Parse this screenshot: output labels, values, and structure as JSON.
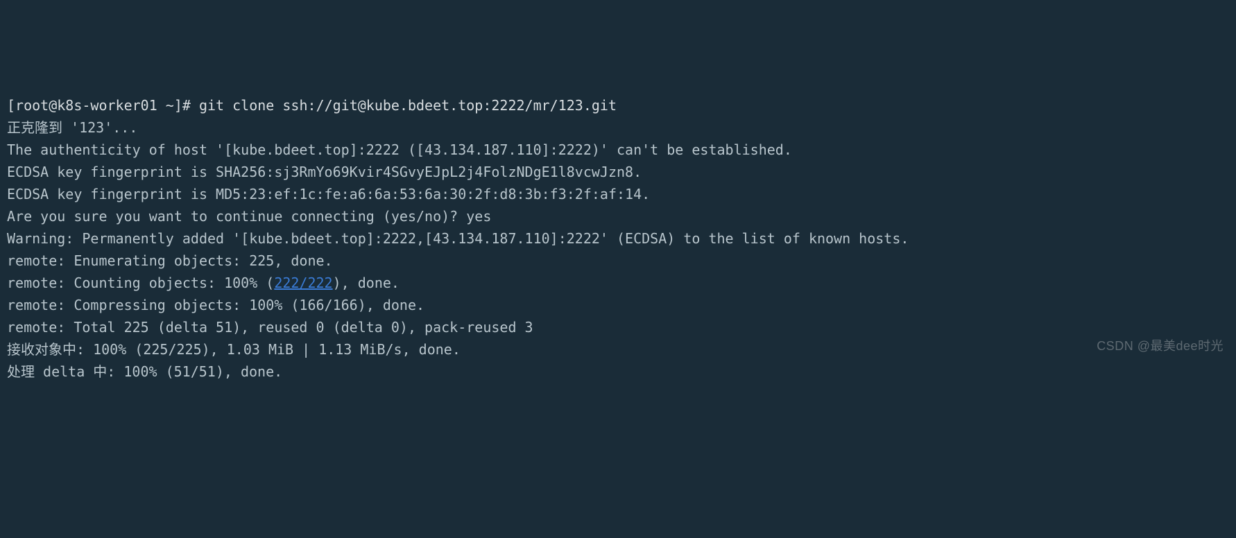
{
  "prompt": {
    "user_host": "[root@k8s-worker01 ~]# ",
    "command": "git clone ssh://git@kube.bdeet.top:2222/mr/123.git"
  },
  "lines": {
    "l1": "正克隆到 '123'...",
    "l2": "The authenticity of host '[kube.bdeet.top]:2222 ([43.134.187.110]:2222)' can't be established.",
    "l3": "ECDSA key fingerprint is SHA256:sj3RmYo69Kvir4SGvyEJpL2j4FolzNDgE1l8vcwJzn8.",
    "l4": "ECDSA key fingerprint is MD5:23:ef:1c:fe:a6:6a:53:6a:30:2f:d8:3b:f3:2f:af:14.",
    "l5a": "Are you sure you want to continue connecting (yes/no)? ",
    "l5b": "yes",
    "l6": "Warning: Permanently added '[kube.bdeet.top]:2222,[43.134.187.110]:2222' (ECDSA) to the list of known hosts.",
    "l7": "remote: Enumerating objects: 225, done.",
    "l8a": "remote: Counting objects: 100% (",
    "l8link": "222/222",
    "l8b": "), done.",
    "l9": "remote: Compressing objects: 100% (166/166), done.",
    "l10": "remote: Total 225 (delta 51), reused 0 (delta 0), pack-reused 3",
    "l11": "接收对象中: 100% (225/225), 1.03 MiB | 1.13 MiB/s, done.",
    "l12": "处理 delta 中: 100% (51/51), done."
  },
  "watermark": "CSDN @最美dee时光"
}
